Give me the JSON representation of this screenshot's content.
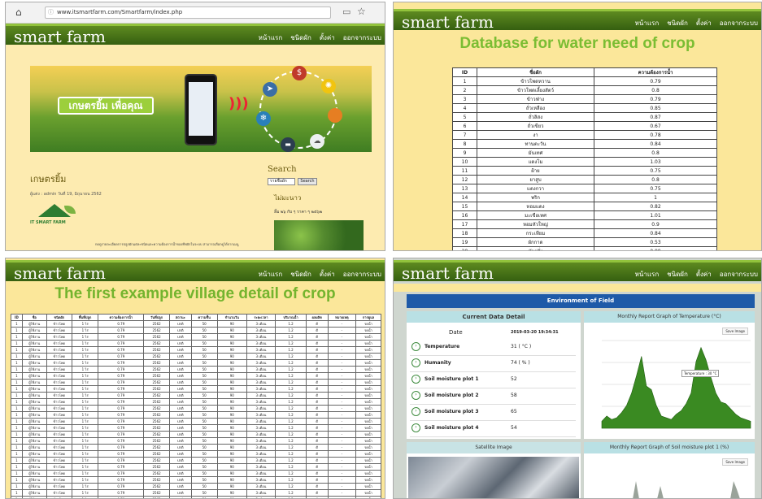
{
  "p1": {
    "url": "www.itsmartfarm.com/Smartfarm/index.php",
    "logo": "smart farm",
    "nav": [
      "หน้าแรก",
      "ชนิดผัก",
      "ตั้งค่า",
      "ออกจากระบบ"
    ],
    "banner_text": "เกษตรยิ้ม เพื่อคุณ",
    "post_title": "เกษตรยิ้ม",
    "post_meta": "ผู้แต่ง : admin วันที่ 19, มิถุนายน 2562",
    "search_title": "Search",
    "search_select": "รายชื่อผัก",
    "search_button": "Search",
    "side_title": "ไม่มะนาว",
    "side_text": "ลิ้ม ๒๖ กับ ๆ ราคา ๆ ๒๕๖๒",
    "footer_note": "กดดูรายละเอียดการปลูกผักแต่ละชนิดและความต้องการน้ำของพืชผักในระบบ สามารถเลือกดูได้จากเมนู",
    "logo_badge": "IT SMART FARM"
  },
  "p2": {
    "logo": "smart farm",
    "nav": [
      "หน้าแรก",
      "ชนิดผัก",
      "ตั้งค่า",
      "ออกจากระบบ"
    ],
    "title": "Database for water need of crop",
    "headers": [
      "ID",
      "ชื่อผัก",
      "ความต้องการน้ำ"
    ],
    "rows": [
      [
        "1",
        "ข้าวโพดหวาน",
        "0.79"
      ],
      [
        "2",
        "ข้าวโพดเลี้ยงสัตว์",
        "0.8"
      ],
      [
        "3",
        "ข้าวฟ่าง",
        "0.79"
      ],
      [
        "4",
        "ถั่วเหลือง",
        "0.85"
      ],
      [
        "5",
        "ถั่วลิสง",
        "0.87"
      ],
      [
        "6",
        "ถั่วเขียว",
        "0.67"
      ],
      [
        "7",
        "งา",
        "0.78"
      ],
      [
        "8",
        "ทานตะวัน",
        "0.84"
      ],
      [
        "9",
        "มันเทศ",
        "0.8"
      ],
      [
        "10",
        "แตงโม",
        "1.03"
      ],
      [
        "11",
        "ฝ้าย",
        "0.75"
      ],
      [
        "12",
        "ยาสูบ",
        "0.8"
      ],
      [
        "13",
        "แตงกวา",
        "0.75"
      ],
      [
        "14",
        "พริก",
        "1"
      ],
      [
        "15",
        "หอมแดง",
        "0.82"
      ],
      [
        "16",
        "มะเขือเทศ",
        "1.01"
      ],
      [
        "17",
        "หอมหัวใหญ่",
        "0.9"
      ],
      [
        "18",
        "กระเทียม",
        "0.84"
      ],
      [
        "19",
        "ผักกาด",
        "0.53"
      ],
      [
        "20",
        "มันฝรั่ง",
        "0.89"
      ],
      [
        "21",
        "ผักชี",
        "0.79"
      ],
      [
        "22",
        "ถั่วฝักยาว",
        "0.75"
      ],
      [
        "23",
        "ผักบุ้ง",
        "0.84"
      ]
    ]
  },
  "p3": {
    "logo": "smart farm",
    "nav": [
      "หน้าแรก",
      "ชนิดผัก",
      "ตั้งค่า",
      "ออกจากระบบ"
    ],
    "title": "The first example village detail of crop",
    "headers": [
      "ID",
      "ชื่อ",
      "ชนิดผัก",
      "พื้นที่ปลูก",
      "ความต้องการน้ำ",
      "วันที่ปลูก",
      "สถานะ",
      "ความชื้น",
      "จำนวนวัน",
      "ระยะเวลา",
      "ปริมาณน้ำ",
      "ผลผลิต",
      "หมายเหตุ",
      "การดูแล"
    ],
    "row": [
      "1",
      "ผู้ใช้งาน",
      "ข้าวโพด",
      "1 ไร่",
      "0.79",
      "2562",
      "ปกติ",
      "50",
      "90",
      "3 เดือน",
      "1.2",
      "ดี",
      "-",
      "รดน้ำ"
    ]
  },
  "p4": {
    "logo": "smart farm",
    "nav": [
      "หน้าแรก",
      "ชนิดผัก",
      "ตั้งค่า",
      "ออกจากระบบ"
    ],
    "header": "Environment of Field",
    "current_title": "Current Data Detail",
    "date_label": "Date",
    "date_value": "2019-03-20 19:34:31",
    "readings": [
      {
        "label": "Temperature",
        "value": "31 ( °C )"
      },
      {
        "label": "Humanity",
        "value": "74 ( % )"
      },
      {
        "label": "Soil moisture plot 1",
        "value": "52"
      },
      {
        "label": "Soil moisture plot 2",
        "value": "58"
      },
      {
        "label": "Soil moisture plot 3",
        "value": "65"
      },
      {
        "label": "Soil moisture plot 4",
        "value": "54"
      }
    ],
    "temp_graph_title": "Monthly Report Graph of Temperature (°C)",
    "soil_graph_title": "Monthly Report Graph of Soil moisture plot 1 (%)",
    "satellite_title": "Satellite Image",
    "export_button": "Save Image",
    "tooltip": "Temperature : 30 °C"
  },
  "chart_data": {
    "type": "area",
    "title": "Monthly Report Graph of Temperature (°C)",
    "series": [
      {
        "values": [
          8,
          14,
          10,
          12,
          18,
          26,
          40,
          60,
          82,
          48,
          44,
          26,
          14,
          12,
          10,
          16,
          20,
          28,
          40,
          76,
          92,
          78,
          58,
          40,
          30,
          28,
          22,
          16,
          12,
          10,
          8
        ]
      }
    ]
  }
}
